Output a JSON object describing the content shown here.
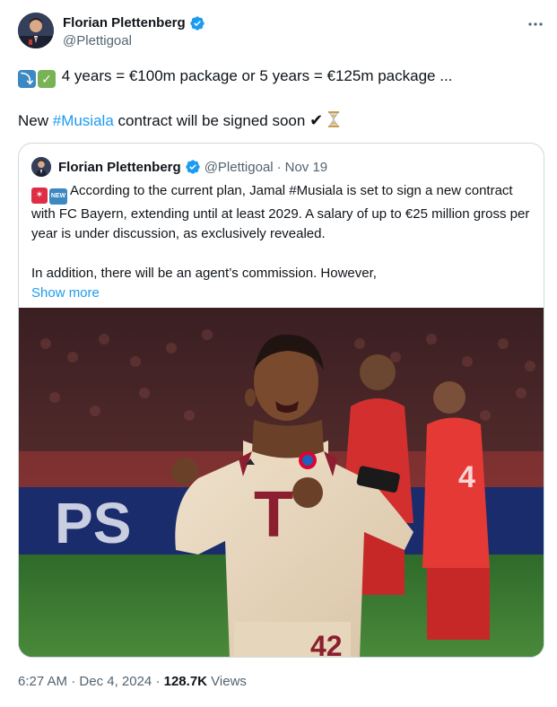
{
  "author": {
    "display_name": "Florian Plettenberg",
    "handle": "@Plettigoal"
  },
  "tweet": {
    "line1": "4 years = €100m package or 5 years = €125m package ...",
    "line2_prefix": "New ",
    "line2_hashtag": "#Musiala",
    "line2_suffix": " contract will be signed soon ",
    "line2_check": "✔"
  },
  "quote": {
    "display_name": "Florian Plettenberg",
    "handle": "@Plettigoal",
    "separator": "·",
    "date": "Nov 19",
    "badge_new": "NEW",
    "paragraph1": "According to the current plan, Jamal #Musiala is set to sign a new contract with FC Bayern, extending until at least 2029. A salary of up to €25 million gross per year is under discussion, as exclusively revealed.",
    "paragraph2": "In addition, there will be an agent’s commission. However,",
    "show_more": "Show more",
    "image_shirt_number": "42",
    "image_sponsor": "T"
  },
  "footer": {
    "time": "6:27 AM",
    "sep1": " · ",
    "date": "Dec 4, 2024",
    "sep2": " · ",
    "views_count": "128.7K",
    "views_label": " Views"
  },
  "colors": {
    "link": "#1d9bf0",
    "secondary_text": "#536471",
    "border": "#cfd9de",
    "verified": "#1d9bf0"
  },
  "icons": [
    "verified-badge-icon",
    "more-options-icon",
    "arrow-down-emoji-icon",
    "check-mark-emoji-icon",
    "heavy-check-icon",
    "hourglass-icon",
    "siren-emoji-icon",
    "new-emoji-icon"
  ]
}
